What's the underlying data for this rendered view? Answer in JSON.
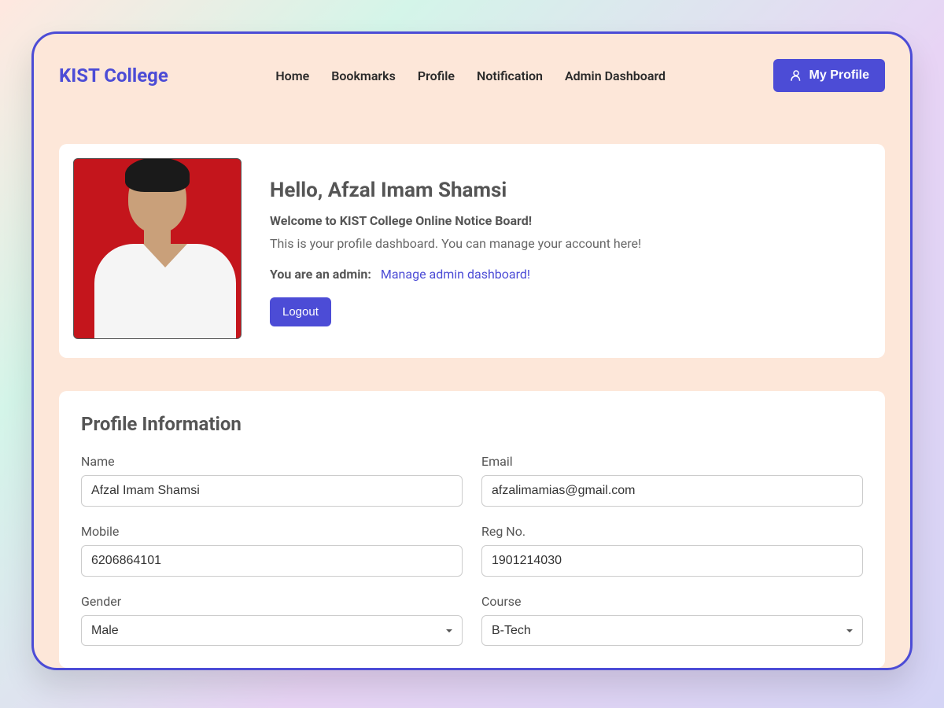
{
  "brand": "KIST College",
  "nav": {
    "items": [
      {
        "label": "Home"
      },
      {
        "label": "Bookmarks"
      },
      {
        "label": "Profile"
      },
      {
        "label": "Notification"
      },
      {
        "label": "Admin Dashboard"
      }
    ],
    "my_profile_label": "My Profile"
  },
  "welcome": {
    "greeting": "Hello, Afzal Imam Shamsi",
    "subtitle": "Welcome to KIST College Online Notice Board!",
    "description": "This is your profile dashboard. You can manage your account here!",
    "admin_prefix": "You are an admin:",
    "admin_link": "Manage admin dashboard!",
    "logout_label": "Logout"
  },
  "profile": {
    "section_title": "Profile Information",
    "fields": {
      "name": {
        "label": "Name",
        "value": "Afzal Imam Shamsi"
      },
      "email": {
        "label": "Email",
        "value": "afzalimamias@gmail.com"
      },
      "mobile": {
        "label": "Mobile",
        "value": "6206864101"
      },
      "regno": {
        "label": "Reg No.",
        "value": "1901214030"
      },
      "gender": {
        "label": "Gender",
        "value": "Male"
      },
      "course": {
        "label": "Course",
        "value": "B-Tech"
      }
    }
  }
}
